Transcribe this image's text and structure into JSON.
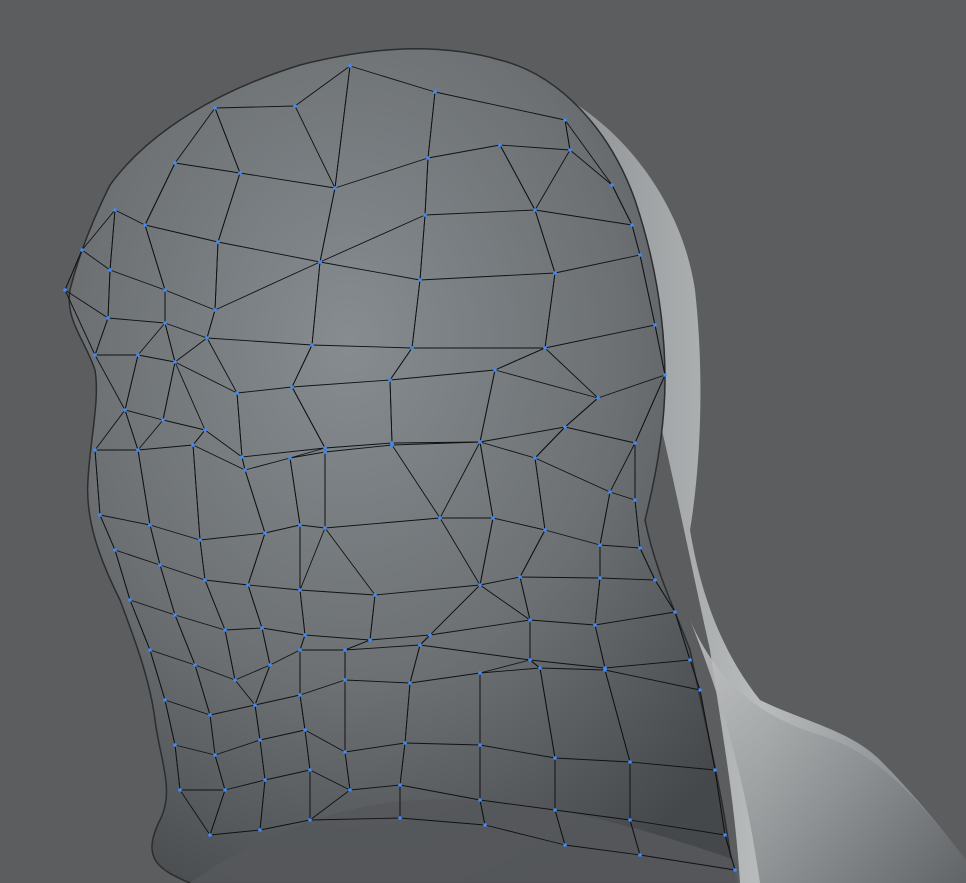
{
  "viewport": {
    "background": "#5b5d5f",
    "mesh_surface": "#6f7376",
    "mesh_highlight": "#848a8e",
    "mesh_shadow": "#3d4043",
    "edge_color": "#101112",
    "vertex_color": "#3d8bff",
    "icons": [
      "3d-mesh-object"
    ]
  }
}
